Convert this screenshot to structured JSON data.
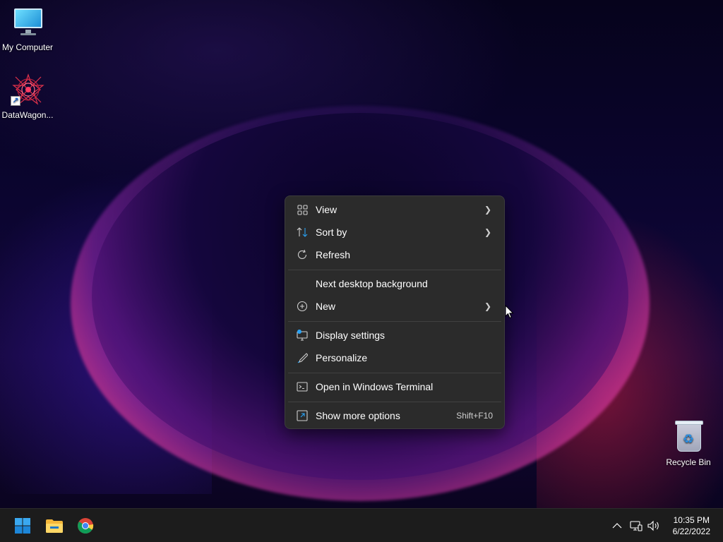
{
  "desktop": {
    "icons": [
      {
        "label": "My Computer",
        "icon": "monitor-icon"
      },
      {
        "label": "DataWagon...",
        "icon": "datawagon-icon"
      },
      {
        "label": "Recycle Bin",
        "icon": "recycle-bin-icon"
      }
    ]
  },
  "context_menu": {
    "items": [
      {
        "label": "View",
        "icon": "grid-icon",
        "has_submenu": true
      },
      {
        "label": "Sort by",
        "icon": "sort-icon",
        "has_submenu": true
      },
      {
        "label": "Refresh",
        "icon": "refresh-icon",
        "has_submenu": false
      },
      {
        "label": "Next desktop background",
        "icon": "",
        "has_submenu": false
      },
      {
        "label": "New",
        "icon": "plus-circle-icon",
        "has_submenu": true
      },
      {
        "label": "Display settings",
        "icon": "display-icon",
        "has_submenu": false
      },
      {
        "label": "Personalize",
        "icon": "brush-icon",
        "has_submenu": false
      },
      {
        "label": "Open in Windows Terminal",
        "icon": "terminal-icon",
        "has_submenu": false
      },
      {
        "label": "Show more options",
        "icon": "expand-icon",
        "has_submenu": false,
        "shortcut": "Shift+F10"
      }
    ]
  },
  "taskbar": {
    "apps": [
      {
        "name": "Start",
        "icon": "windows-logo-icon"
      },
      {
        "name": "File Explorer",
        "icon": "folder-icon"
      },
      {
        "name": "Google Chrome",
        "icon": "chrome-icon"
      }
    ],
    "tray": {
      "icons": [
        "chevron-up-icon",
        "network-icon",
        "volume-icon"
      ],
      "time": "10:35 PM",
      "date": "6/22/2022"
    }
  },
  "colors": {
    "menu_bg": "#2b2b2b",
    "taskbar_bg": "#1c1c1c",
    "accent_blue": "#2aa3f5"
  }
}
